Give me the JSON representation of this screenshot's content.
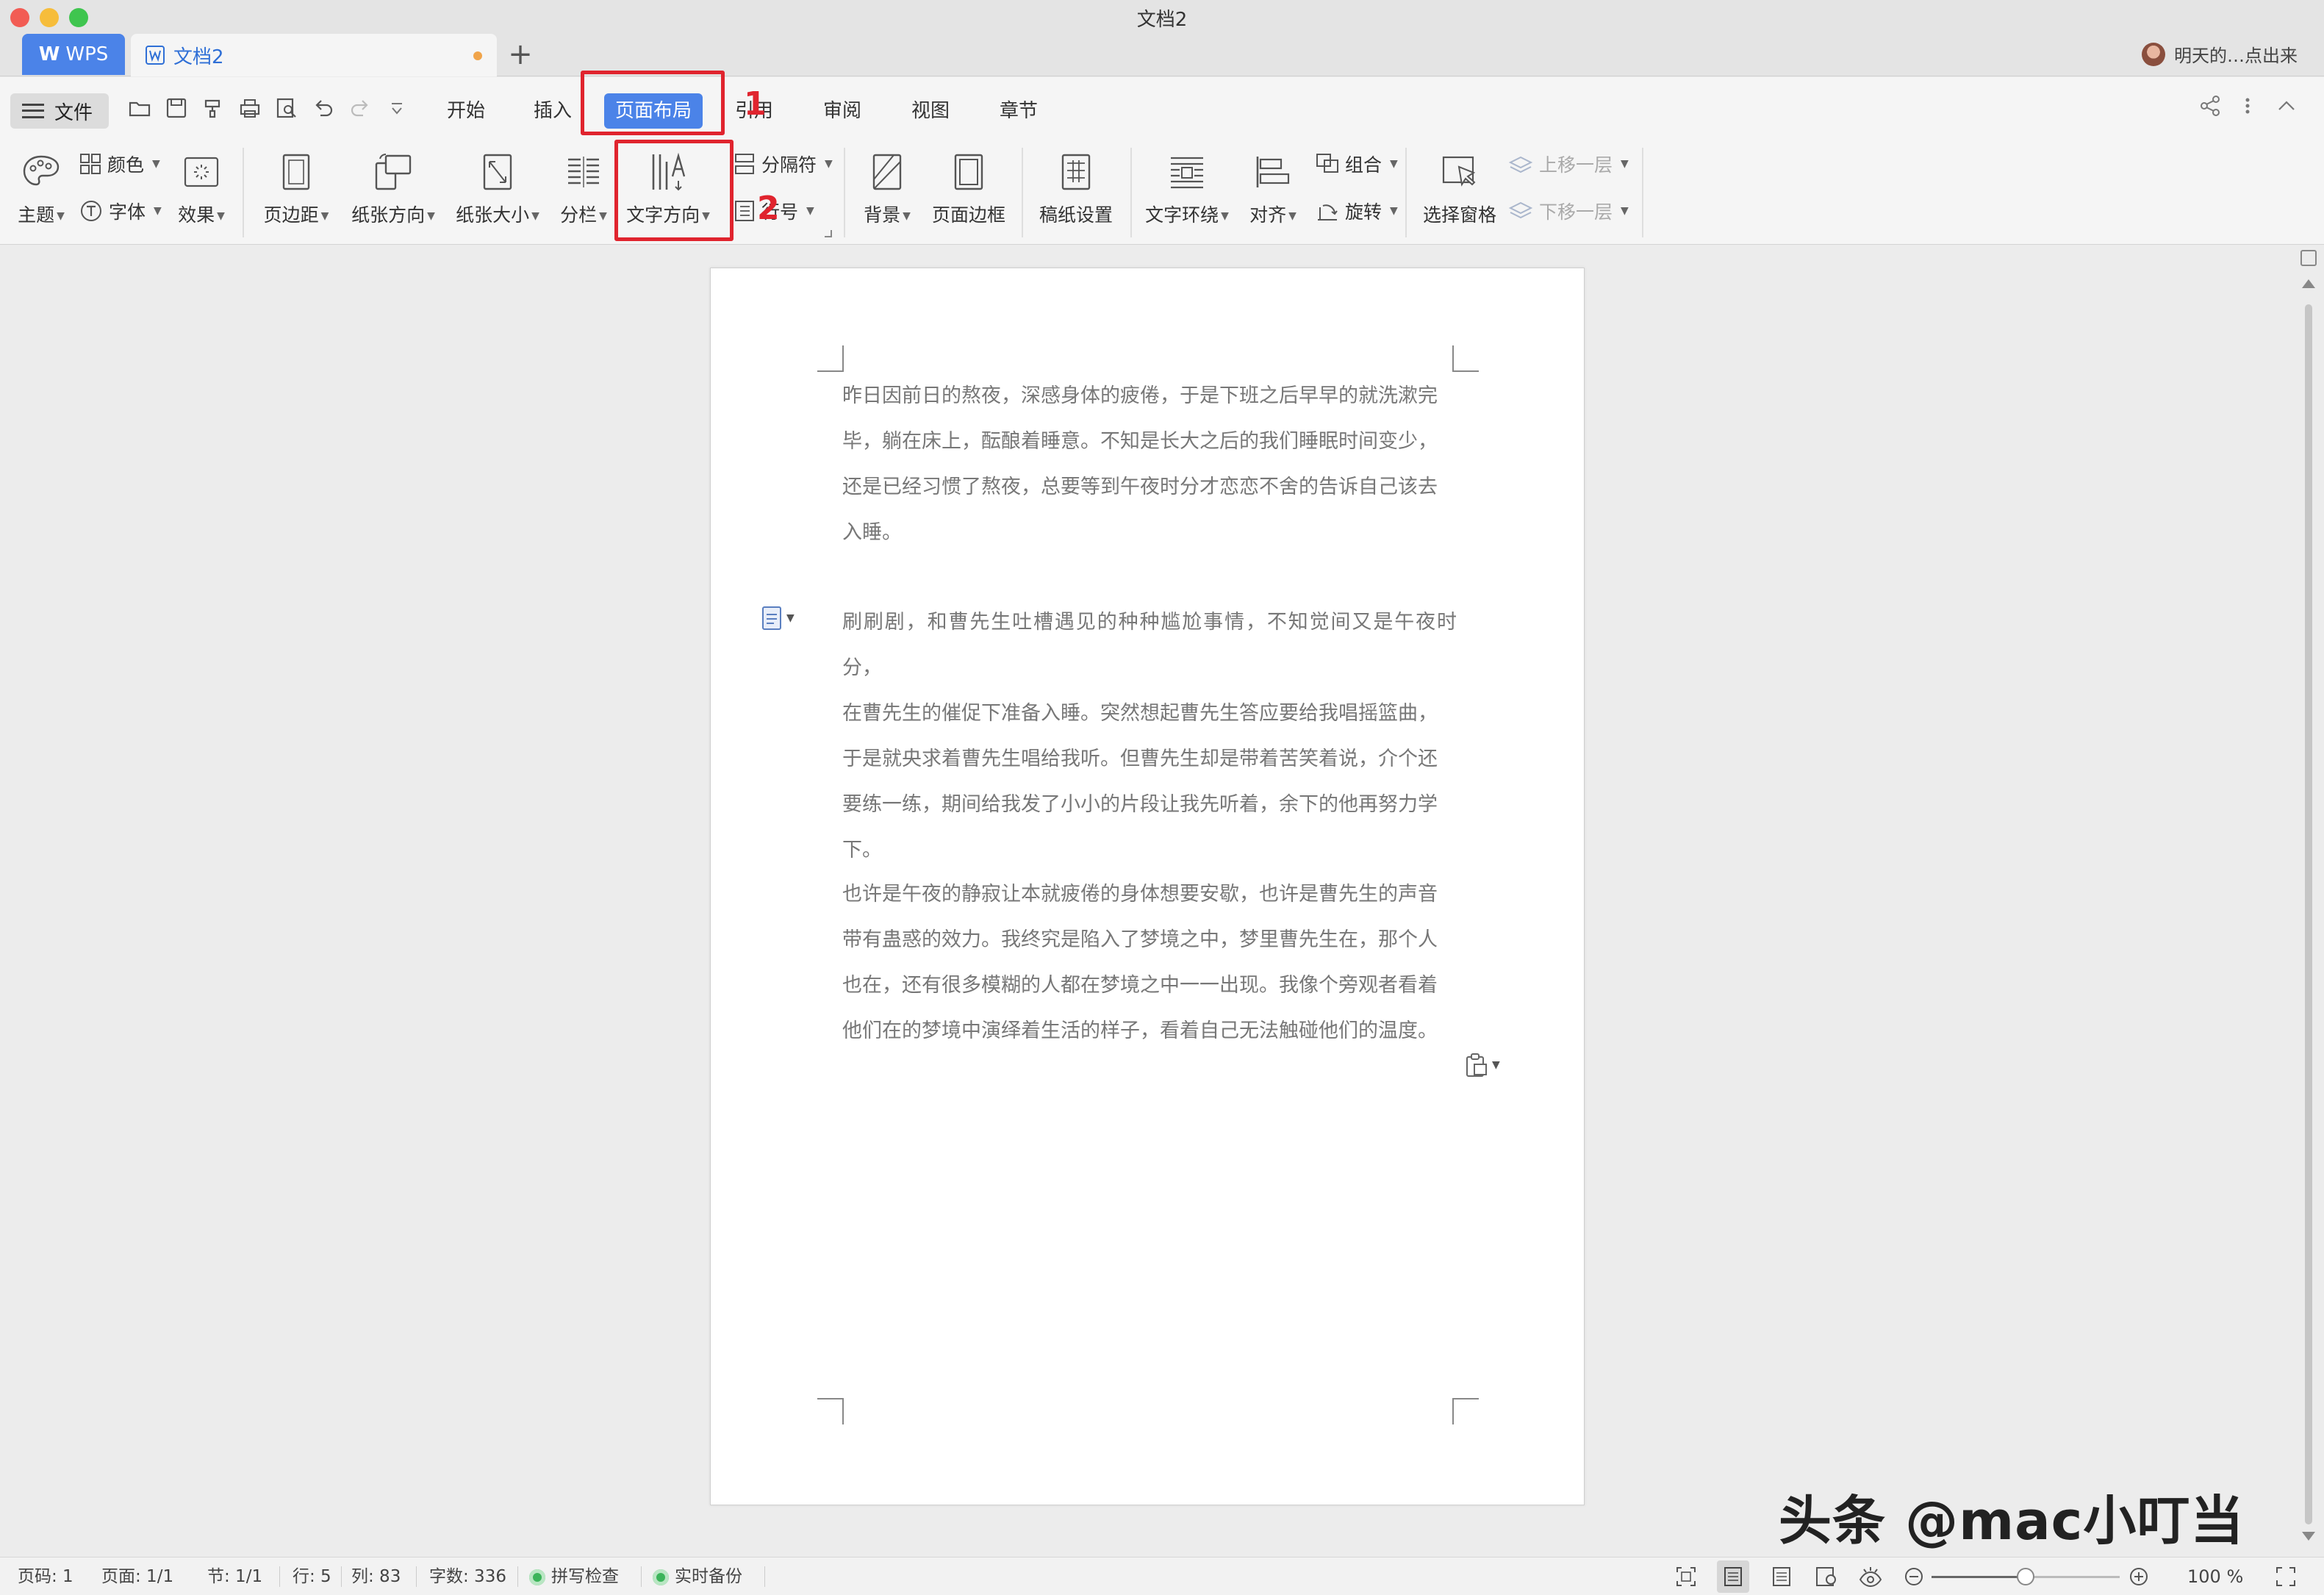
{
  "window": {
    "title": "文档2"
  },
  "tabs": {
    "wps_label": "WPS",
    "doc_label": "文档2",
    "user_name": "明天的…点出来"
  },
  "menu": {
    "file_label": "文件",
    "tabs": [
      "开始",
      "插入",
      "页面布局",
      "引用",
      "审阅",
      "视图",
      "章节"
    ],
    "active_tab": "页面布局"
  },
  "ribbon": {
    "theme": "主题",
    "color": "颜色",
    "font": "字体",
    "effect": "效果",
    "margins": "页边距",
    "orientation": "纸张方向",
    "paper_size": "纸张大小",
    "columns": "分栏",
    "text_direction": "文字方向",
    "separator": "分隔符",
    "line_number": "行号",
    "background": "背景",
    "page_border": "页面边框",
    "manuscript": "稿纸设置",
    "text_wrap": "文字环绕",
    "align": "对齐",
    "group": "组合",
    "rotate": "旋转",
    "select_pane": "选择窗格",
    "bring_forward": "上移一层",
    "send_backward": "下移一层"
  },
  "annotations": {
    "step1": "1",
    "step2": "2",
    "accent": "#e0242e"
  },
  "document": {
    "paragraphs": [
      [
        "昨日因前日的熬夜，深感身体的疲倦，于是下班之后早早的就洗漱完",
        "毕，躺在床上，酝酿着睡意。不知是长大之后的我们睡眠时间变少，",
        "还是已经习惯了熬夜，总要等到午夜时分才恋恋不舍的告诉自己该去",
        "入睡。"
      ],
      [
        "刷刷剧，和曹先生吐槽遇见的种种尴尬事情，不知觉间又是午夜时分，",
        "在曹先生的催促下准备入睡。突然想起曹先生答应要给我唱摇篮曲，",
        "于是就央求着曹先生唱给我听。但曹先生却是带着苦笑着说，介个还",
        "要练一练，期间给我发了小小的片段让我先听着，余下的他再努力学",
        "下。"
      ],
      [
        "也许是午夜的静寂让本就疲倦的身体想要安歇，也许是曹先生的声音",
        "带有蛊惑的效力。我终究是陷入了梦境之中，梦里曹先生在，那个人",
        "也在，还有很多模糊的人都在梦境之中一一出现。我像个旁观者看着",
        "他们在的梦境中演绎着生活的样子，看着自己无法触碰他们的温度。"
      ]
    ]
  },
  "status": {
    "page_code": "页码: 1",
    "pages": "页面: 1/1",
    "section": "节: 1/1",
    "row": "行: 5",
    "col": "列: 83",
    "word_count": "字数: 336",
    "spell_check": "拼写检查",
    "backup": "实时备份",
    "zoom": "100 %"
  },
  "watermark": "头条 @mac小叮当",
  "icons": {
    "close": "close-dot-icon",
    "minimize": "minimize-dot-icon",
    "maximize": "maximize-dot-icon"
  },
  "colors": {
    "accent_blue": "#4b83e8",
    "highlight_red": "#e0242e"
  }
}
